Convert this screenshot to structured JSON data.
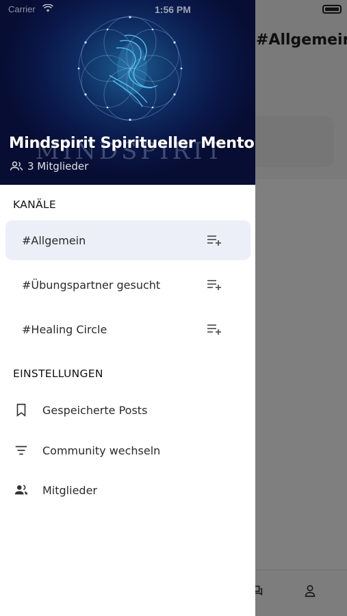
{
  "status_bar": {
    "carrier": "Carrier",
    "time": "1:56 PM"
  },
  "background": {
    "title": "#Allgemein"
  },
  "drawer": {
    "community_name": "Mindspirit Spiritueller Mentor",
    "member_count": "3 Mitglieder",
    "channels_heading": "KANÄLE",
    "channels": [
      {
        "label": "#Allgemein",
        "active": true
      },
      {
        "label": "#Übungspartner gesucht",
        "active": false
      },
      {
        "label": "#Healing Circle",
        "active": false
      }
    ],
    "settings_heading": "EINSTELLUNGEN",
    "settings": [
      {
        "label": "Gespeicherte Posts",
        "icon": "bookmark-icon"
      },
      {
        "label": "Community wechseln",
        "icon": "filter-list-icon"
      },
      {
        "label": "Mitglieder",
        "icon": "people-icon"
      }
    ]
  },
  "colors": {
    "active_channel_bg": "#eceef8",
    "header_bg": "#0a1748"
  }
}
